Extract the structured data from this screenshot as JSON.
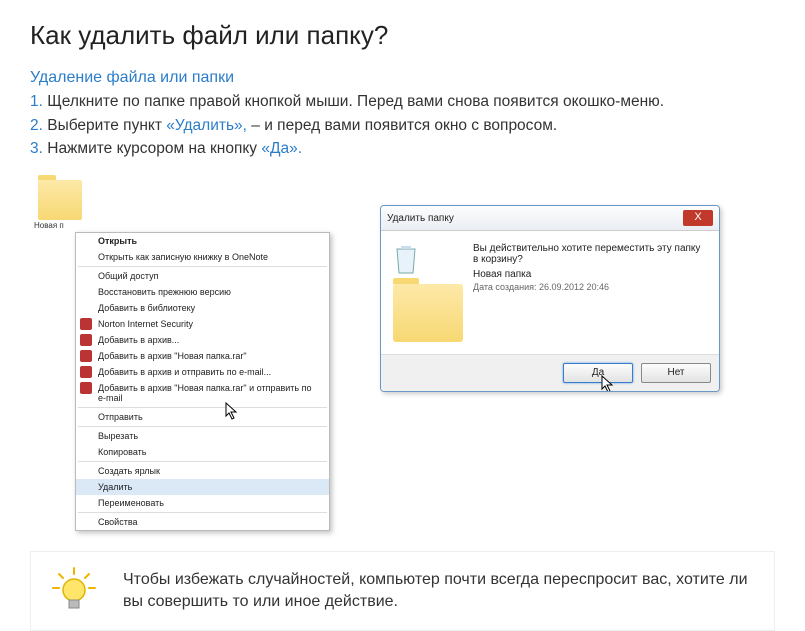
{
  "title": "Как удалить файл или папку?",
  "subtitle": "Удаление файла или папки",
  "steps": [
    {
      "num": "1.",
      "text_before": " Щелкните по папке правой кнопкой мыши. Перед вами снова появится окошко-меню.",
      "hl": "",
      "text_after": ""
    },
    {
      "num": "2.",
      "text_before": " Выберите пункт ",
      "hl": "«Удалить»,",
      "text_after": " – и перед вами появится окно с вопросом."
    },
    {
      "num": "3.",
      "text_before": " Нажмите курсором на кнопку ",
      "hl": "«Да».",
      "text_after": ""
    }
  ],
  "folder_label": "Новая п",
  "context_menu": [
    {
      "label": "Открыть",
      "bold": true
    },
    {
      "label": "Открыть как записную книжку в OneNote"
    },
    {
      "sep": true
    },
    {
      "label": "Общий доступ"
    },
    {
      "label": "Восстановить прежнюю версию"
    },
    {
      "label": "Добавить в библиотеку"
    },
    {
      "label": "Norton Internet Security",
      "icon": "red"
    },
    {
      "label": "Добавить в архив...",
      "icon": "red"
    },
    {
      "label": "Добавить в архив \"Новая папка.rar\"",
      "icon": "red"
    },
    {
      "label": "Добавить в архив и отправить по e-mail...",
      "icon": "red"
    },
    {
      "label": "Добавить в архив \"Новая папка.rar\" и отправить по e-mail",
      "icon": "red"
    },
    {
      "sep": true
    },
    {
      "label": "Отправить"
    },
    {
      "sep": true
    },
    {
      "label": "Вырезать"
    },
    {
      "label": "Копировать"
    },
    {
      "sep": true
    },
    {
      "label": "Создать ярлык"
    },
    {
      "label": "Удалить",
      "hover": true
    },
    {
      "label": "Переименовать"
    },
    {
      "sep": true
    },
    {
      "label": "Свойства"
    }
  ],
  "dialog": {
    "title": "Удалить папку",
    "message": "Вы действительно хотите переместить эту папку в корзину?",
    "name": "Новая папка",
    "date": "Дата создания: 26.09.2012 20:46",
    "btn_yes": "Да",
    "btn_no": "Нет",
    "close": "X"
  },
  "tip": "Чтобы избежать случайностей, компьютер почти всегда переспросит вас, хотите ли вы совершить то или иное действие."
}
